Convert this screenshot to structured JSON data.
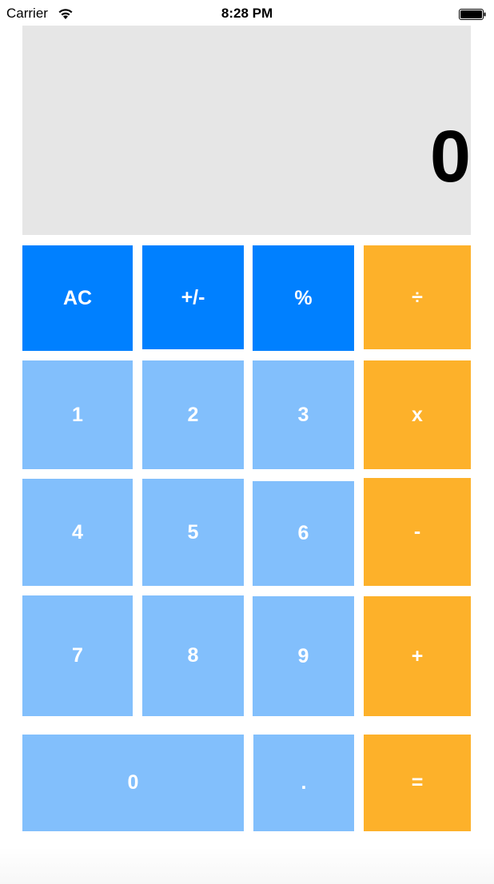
{
  "status_bar": {
    "carrier": "Carrier",
    "time": "8:28 PM",
    "wifi_icon": "wifi-icon",
    "battery_icon": "battery-icon"
  },
  "display": {
    "value": "0"
  },
  "keys": {
    "ac": "AC",
    "plus_minus": "+/-",
    "percent": "%",
    "divide": "÷",
    "one": "1",
    "two": "2",
    "three": "3",
    "multiply": "x",
    "four": "4",
    "five": "5",
    "six": "6",
    "minus": "-",
    "seven": "7",
    "eight": "8",
    "nine": "9",
    "plus": "+",
    "zero": "0",
    "decimal": ".",
    "equals": "="
  },
  "colors": {
    "function_keys": "#0080ff",
    "digit_keys": "#82bffc",
    "operator_keys": "#fdb12a",
    "display_background": "#e6e6e6"
  }
}
